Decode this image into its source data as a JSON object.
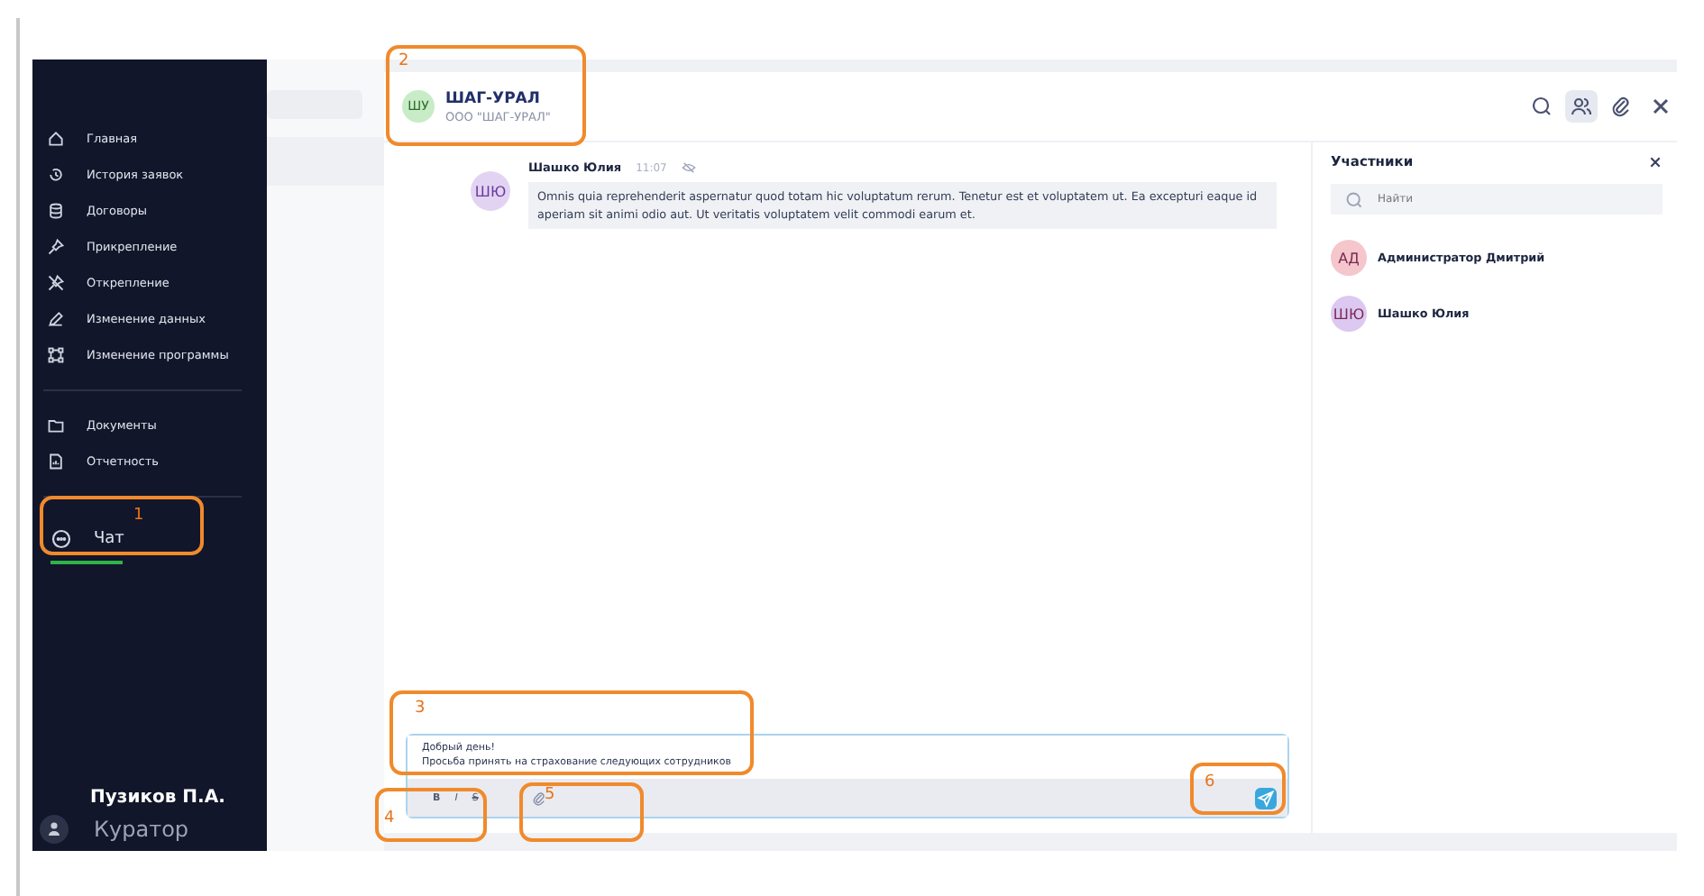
{
  "sidebar": {
    "items": [
      {
        "label": "Главная",
        "selected": false
      },
      {
        "label": "История заявок",
        "selected": false
      },
      {
        "label": "Договоры",
        "selected": false
      },
      {
        "label": "Прикрепление",
        "selected": false
      },
      {
        "label": "Открепление",
        "selected": false
      },
      {
        "label": "Изменение данных",
        "selected": false
      },
      {
        "label": "Изменение программы",
        "selected": false
      },
      {
        "label": "Документы",
        "selected": false
      },
      {
        "label": "Отчетность",
        "selected": false
      },
      {
        "label": "Чат",
        "selected": true
      }
    ],
    "user": {
      "name": "Пузиков П.А.",
      "role": "Куратор"
    }
  },
  "chat": {
    "avatar": "ШУ",
    "title": "ШАГ-УРАЛ",
    "subtitle": "ООО \"ШАГ-УРАЛ\"",
    "header_buttons": [
      {
        "selected": false
      },
      {
        "selected": true
      },
      {
        "selected": false
      },
      {
        "selected": false
      }
    ],
    "messages": [
      {
        "avatar": "ШЮ",
        "author": "Шашко Юлия",
        "time": "11:07",
        "text": "Omnis quia reprehenderit aspernatur quod totam hic voluptatum rerum. Tenetur est et voluptatem ut. Ea excepturi eaque id aperiam sit animi odio aut. Ut veritatis voluptatem velit commodi earum et."
      }
    ],
    "composer": {
      "value": "Добрый день!\nПросьба принять на страхование следующих сотрудников",
      "format_buttons": [
        "B",
        "I",
        "S"
      ]
    }
  },
  "participants": {
    "title": "Участники",
    "search_placeholder": "Найти",
    "items": [
      {
        "avatar": "АД",
        "name": "Администратор Дмитрий",
        "color": "#f5c6cb"
      },
      {
        "avatar": "ШЮ",
        "name": "Шашко Юлия",
        "color": "#dcc8f0"
      }
    ]
  },
  "annotations": [
    {
      "label": "1",
      "kind": "callout"
    },
    {
      "label": "2",
      "kind": "callout"
    },
    {
      "label": "3",
      "kind": "callout"
    },
    {
      "label": "4",
      "kind": "callout"
    },
    {
      "label": "5",
      "kind": "callout"
    },
    {
      "label": "6",
      "kind": "callout"
    }
  ]
}
